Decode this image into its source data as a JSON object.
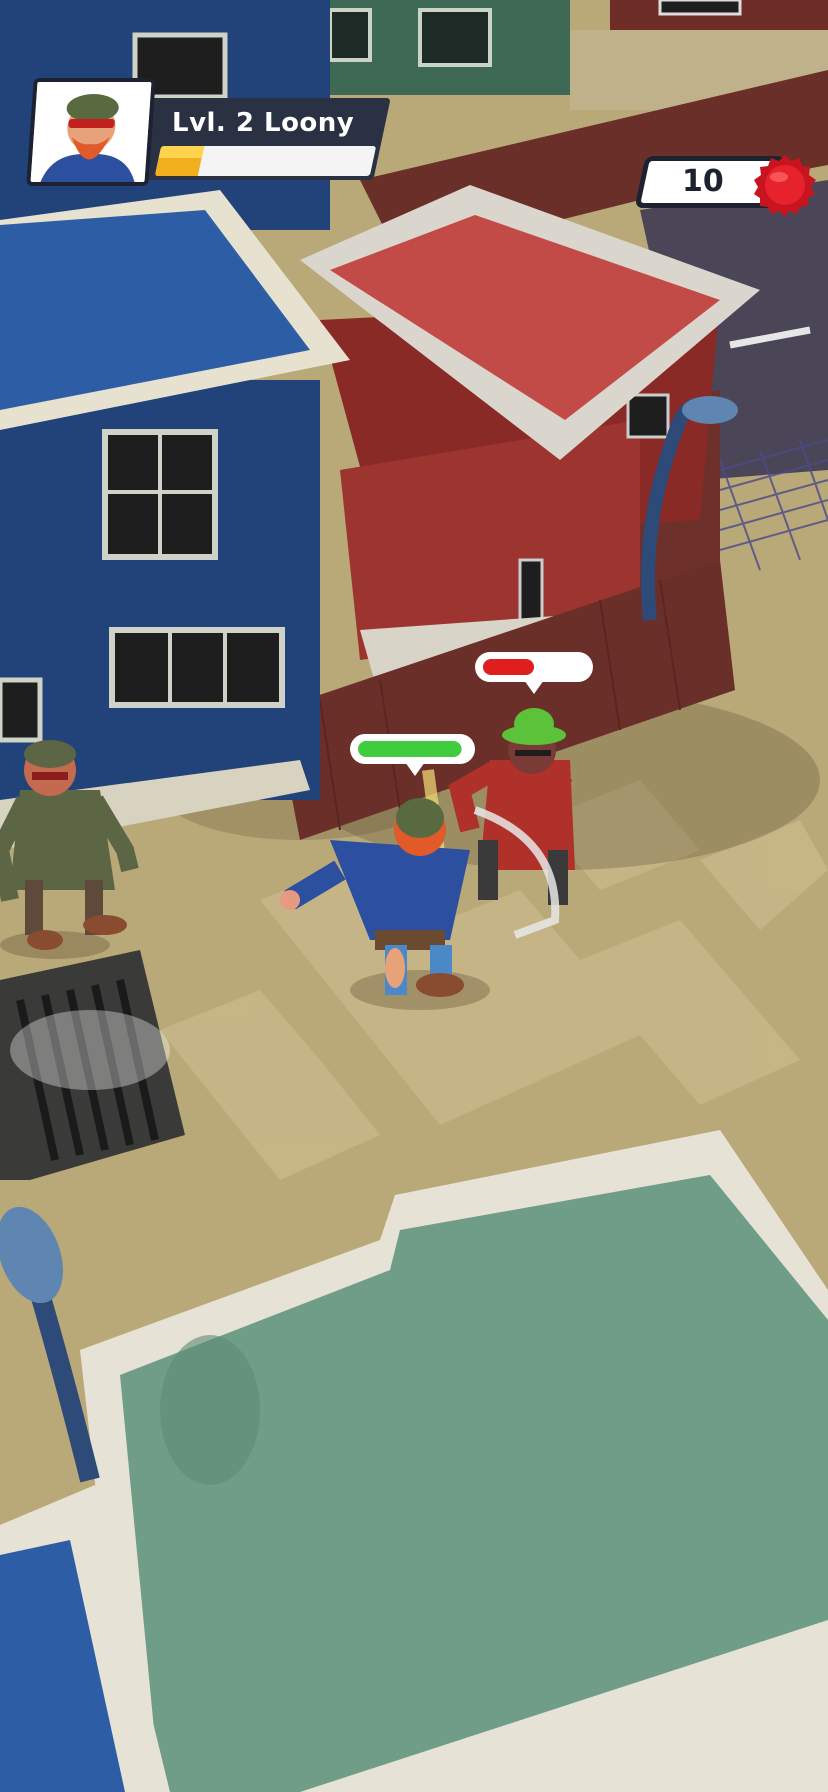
{
  "hud": {
    "player": {
      "level_text": "Lvl. 2 Loony",
      "xp_progress": 0.2,
      "portrait_icon": "bearded-loony-portrait"
    },
    "coins": {
      "count": "10",
      "icon": "red-bottle-cap-icon"
    }
  },
  "combat": {
    "player_health": 0.95,
    "enemy_health": 0.5,
    "player_health_color": "#3fcd3f",
    "enemy_health_color": "#e01e1e"
  },
  "colors": {
    "ground": "#b9a978",
    "building_blue": "#22427a",
    "building_red": "#8a2a26",
    "roof_red": "#c24a47",
    "roof_teal": "#6f9d88",
    "fence": "#6b2f2a"
  }
}
